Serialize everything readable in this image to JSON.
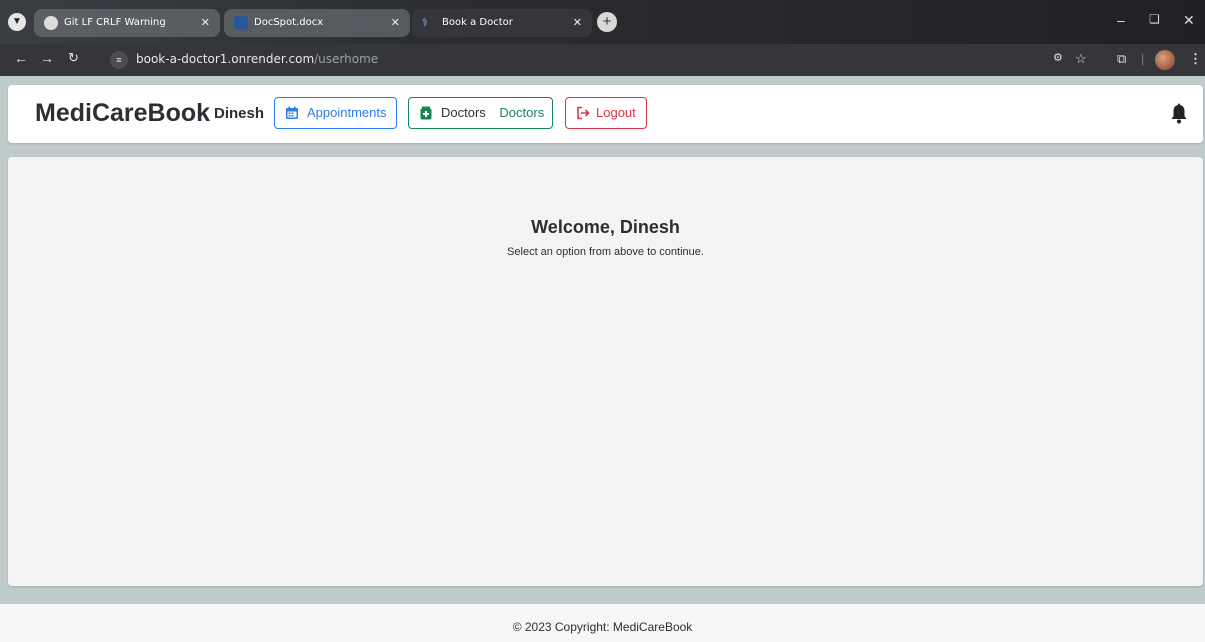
{
  "browser": {
    "tabs": [
      {
        "title": "Git LF CRLF Warning",
        "active": false
      },
      {
        "title": "DocSpot.docx",
        "active": false
      },
      {
        "title": "Book a Doctor",
        "active": true
      }
    ],
    "url_host": "book-a-doctor1.onrender.com",
    "url_path": "/userhome",
    "icons": {
      "tab_menu": "chevron-down-icon",
      "close": "close-icon",
      "new_tab": "plus-icon",
      "back": "arrow-left-icon",
      "forward": "arrow-right-icon",
      "reload": "reload-icon",
      "site_info": "site-settings-icon",
      "password": "key-icon",
      "bookmark": "star-icon",
      "extensions": "puzzle-icon",
      "menu": "kebab-menu-icon"
    }
  },
  "header": {
    "brand": "MediCareBook",
    "username": "Dinesh",
    "appointments_label": "Appointments",
    "doctors_label": "Doctors",
    "doctors_secondary": "Doctors",
    "logout_label": "Logout",
    "icons": {
      "appointments": "calendar-icon",
      "doctors": "medical-kit-icon",
      "logout": "logout-icon",
      "notifications": "bell-icon"
    }
  },
  "main": {
    "welcome": "Welcome, Dinesh",
    "subtitle": "Select an option from above to continue."
  },
  "footer": {
    "copyright": "© 2023 Copyright: MediCareBook"
  },
  "colors": {
    "primary": "#2b7de9",
    "success": "#198754",
    "danger": "#dc3545",
    "page_bg": "#bfcbca"
  }
}
